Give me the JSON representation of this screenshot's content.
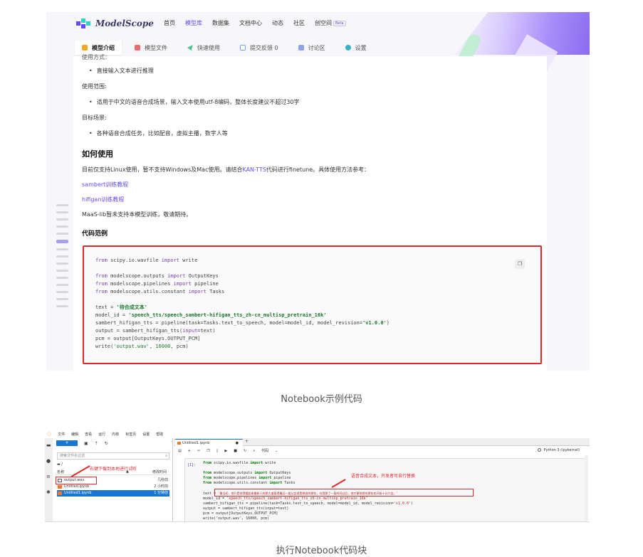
{
  "shot1": {
    "logo_text": "ModelScope",
    "nav": [
      {
        "label": "首页",
        "active": false
      },
      {
        "label": "模型库",
        "active": true
      },
      {
        "label": "数据集",
        "active": false
      },
      {
        "label": "文档中心",
        "active": false
      },
      {
        "label": "动态",
        "active": false
      },
      {
        "label": "社区",
        "active": false
      },
      {
        "label": "创空间",
        "active": false
      }
    ],
    "nav_badge": "Beta",
    "tabs": [
      {
        "label": "模型介绍",
        "icon": "model-intro-icon",
        "color": "#f5a623"
      },
      {
        "label": "模型文件",
        "icon": "file-icon",
        "color": "#f06b6b"
      },
      {
        "label": "快速使用",
        "icon": "send-icon",
        "color": "#4cc38a"
      },
      {
        "label": "提交反馈 0",
        "icon": "edit-icon",
        "color": "#6aa7f5"
      },
      {
        "label": "讨论区",
        "icon": "chat-icon",
        "color": "#8da3e8"
      },
      {
        "label": "设置",
        "icon": "gear-icon",
        "color": "#3ab0c8"
      }
    ],
    "content": {
      "usage_method_partial": "使用方式：",
      "bullet_1": "直接输入文本进行推理",
      "scope_label": "使用范围:",
      "bullet_2": "适用于中文的语音合成场景，输入文本使用utf-8编码，整体长度建议不超过30字",
      "target_label": "目标场景:",
      "bullet_3": "各种语音合成任务，比如配音，虚拟主播，数字人等",
      "heading_how": "如何使用",
      "para_prefix": "目前仅支持Linux使用，暂不支持Windows及Mac使用。请结合",
      "para_link": "KAN-TTS",
      "para_suffix": "代码进行finetune。具体使用方法参考：",
      "link_sambert": "sambert训练教程",
      "link_hifigan": "hifigan训练教程",
      "note": "MaaS-lib暂未支持本模型训练，敬请期待。",
      "heading_code": "代码范例"
    },
    "code": {
      "l1_kw1": "from",
      "l1_mod": " scipy.io.wavfile ",
      "l1_kw2": "import",
      "l1_name": " write",
      "l2_kw1": "from",
      "l2_mod": " modelscope.outputs ",
      "l2_kw2": "import",
      "l2_name": " OutputKeys",
      "l3_kw1": "from",
      "l3_mod": " modelscope.pipelines ",
      "l3_kw2": "import",
      "l3_name": " pipeline",
      "l4_kw1": "from",
      "l4_mod": " modelscope.utils.constant ",
      "l4_kw2": "import",
      "l4_name": " Tasks",
      "l5_pre": "text = ",
      "l5_str": "'待合成文本'",
      "l6_pre": "model_id = ",
      "l6_str": "'speech_tts/speech_sambert-hifigan_tts_zh-cn_multisp_pretrain_16k'",
      "l7_pre": "sambert_hifigan_tts = pipeline(task=Tasks.text_to_speech, model=model_id, model_revision=",
      "l7_str": "'v1.0.0'",
      "l7_post": ")",
      "l8_pre": "output = sambert_hifigan_tts(",
      "l8_kw": "input",
      "l8_post": "=text)",
      "l9": "pcm = output[OutputKeys.OUTPUT_PCM]",
      "l10_pre": "write(",
      "l10_str": "'output.wav'",
      "l10_mid": ", ",
      "l10_num": "16000",
      "l10_post": ", pcm)"
    }
  },
  "caption1": "Notebook示例代码",
  "shot2": {
    "menu": [
      "文件",
      "编辑",
      "查看",
      "运行",
      "内核",
      "标签页",
      "设置",
      "帮助"
    ],
    "fb_plus": "+",
    "filter_placeholder": "搜索文件名过滤",
    "path": "/",
    "col_name": "名称",
    "col_modified": "修改时间",
    "files": [
      {
        "name": "output.wav",
        "time": "几秒前",
        "selected": false,
        "icon_color": "#555"
      },
      {
        "name": "Untitled.ipynb",
        "time": "2 小时前",
        "selected": false,
        "icon_color": "#f37726"
      },
      {
        "name": "Untitled1.ipynb",
        "time": "1 分钟前",
        "selected": true,
        "icon_color": "#f37726"
      }
    ],
    "note_download": "右键下载到本地进行试听",
    "tab_name": "Untitled1.ipynb",
    "celltype": "代码",
    "kernel": "Python 3 (ipykernel)",
    "prompt": "[1]:",
    "note_text": "语音合成文本，开发者可自行替换",
    "code": {
      "l1_kw1": "from",
      "l1_mod": " scipy.io.wavfile ",
      "l1_kw2": "import",
      "l1_name": " write",
      "l2_kw1": "from",
      "l2_mod": " modelscope.outputs ",
      "l2_kw2": "import",
      "l2_name": " OutputKeys",
      "l3_kw1": "from",
      "l3_mod": " modelscope.pipelines ",
      "l3_kw2": "import",
      "l3_name": " pipeline",
      "l4_kw1": "from",
      "l4_mod": " modelscope.utils.constant ",
      "l4_kw2": "import",
      "l4_name": " Tasks",
      "l5_pre": "text = ",
      "l5_str": "'最当初，他只是觉得看起来最新人的那大道离得最远一般父女说是想说的那些，在我那了一段时间过后，他才更熟悉的那些也开始十分少女。'",
      "l6_pre": "model_id = ",
      "l6_str": "'speech_tts/speech_sambert-hifigan_tts_zh-cn_multisp_pretrain_16k'",
      "l7_pre": "sambert_hifigan_tts = pipeline(task=Tasks.text_to_speech, model=model_id, model_revision=",
      "l7_str": "'v1.0.0'",
      "l7_post": ")",
      "l8": "output = sambert_hifigan_tts(input=text)",
      "l9": "pcm = output[OutputKeys.OUTPUT_PCM]",
      "l10": "write('output.wav', 16000, pcm)"
    }
  },
  "caption2": "执行Notebook代码块"
}
